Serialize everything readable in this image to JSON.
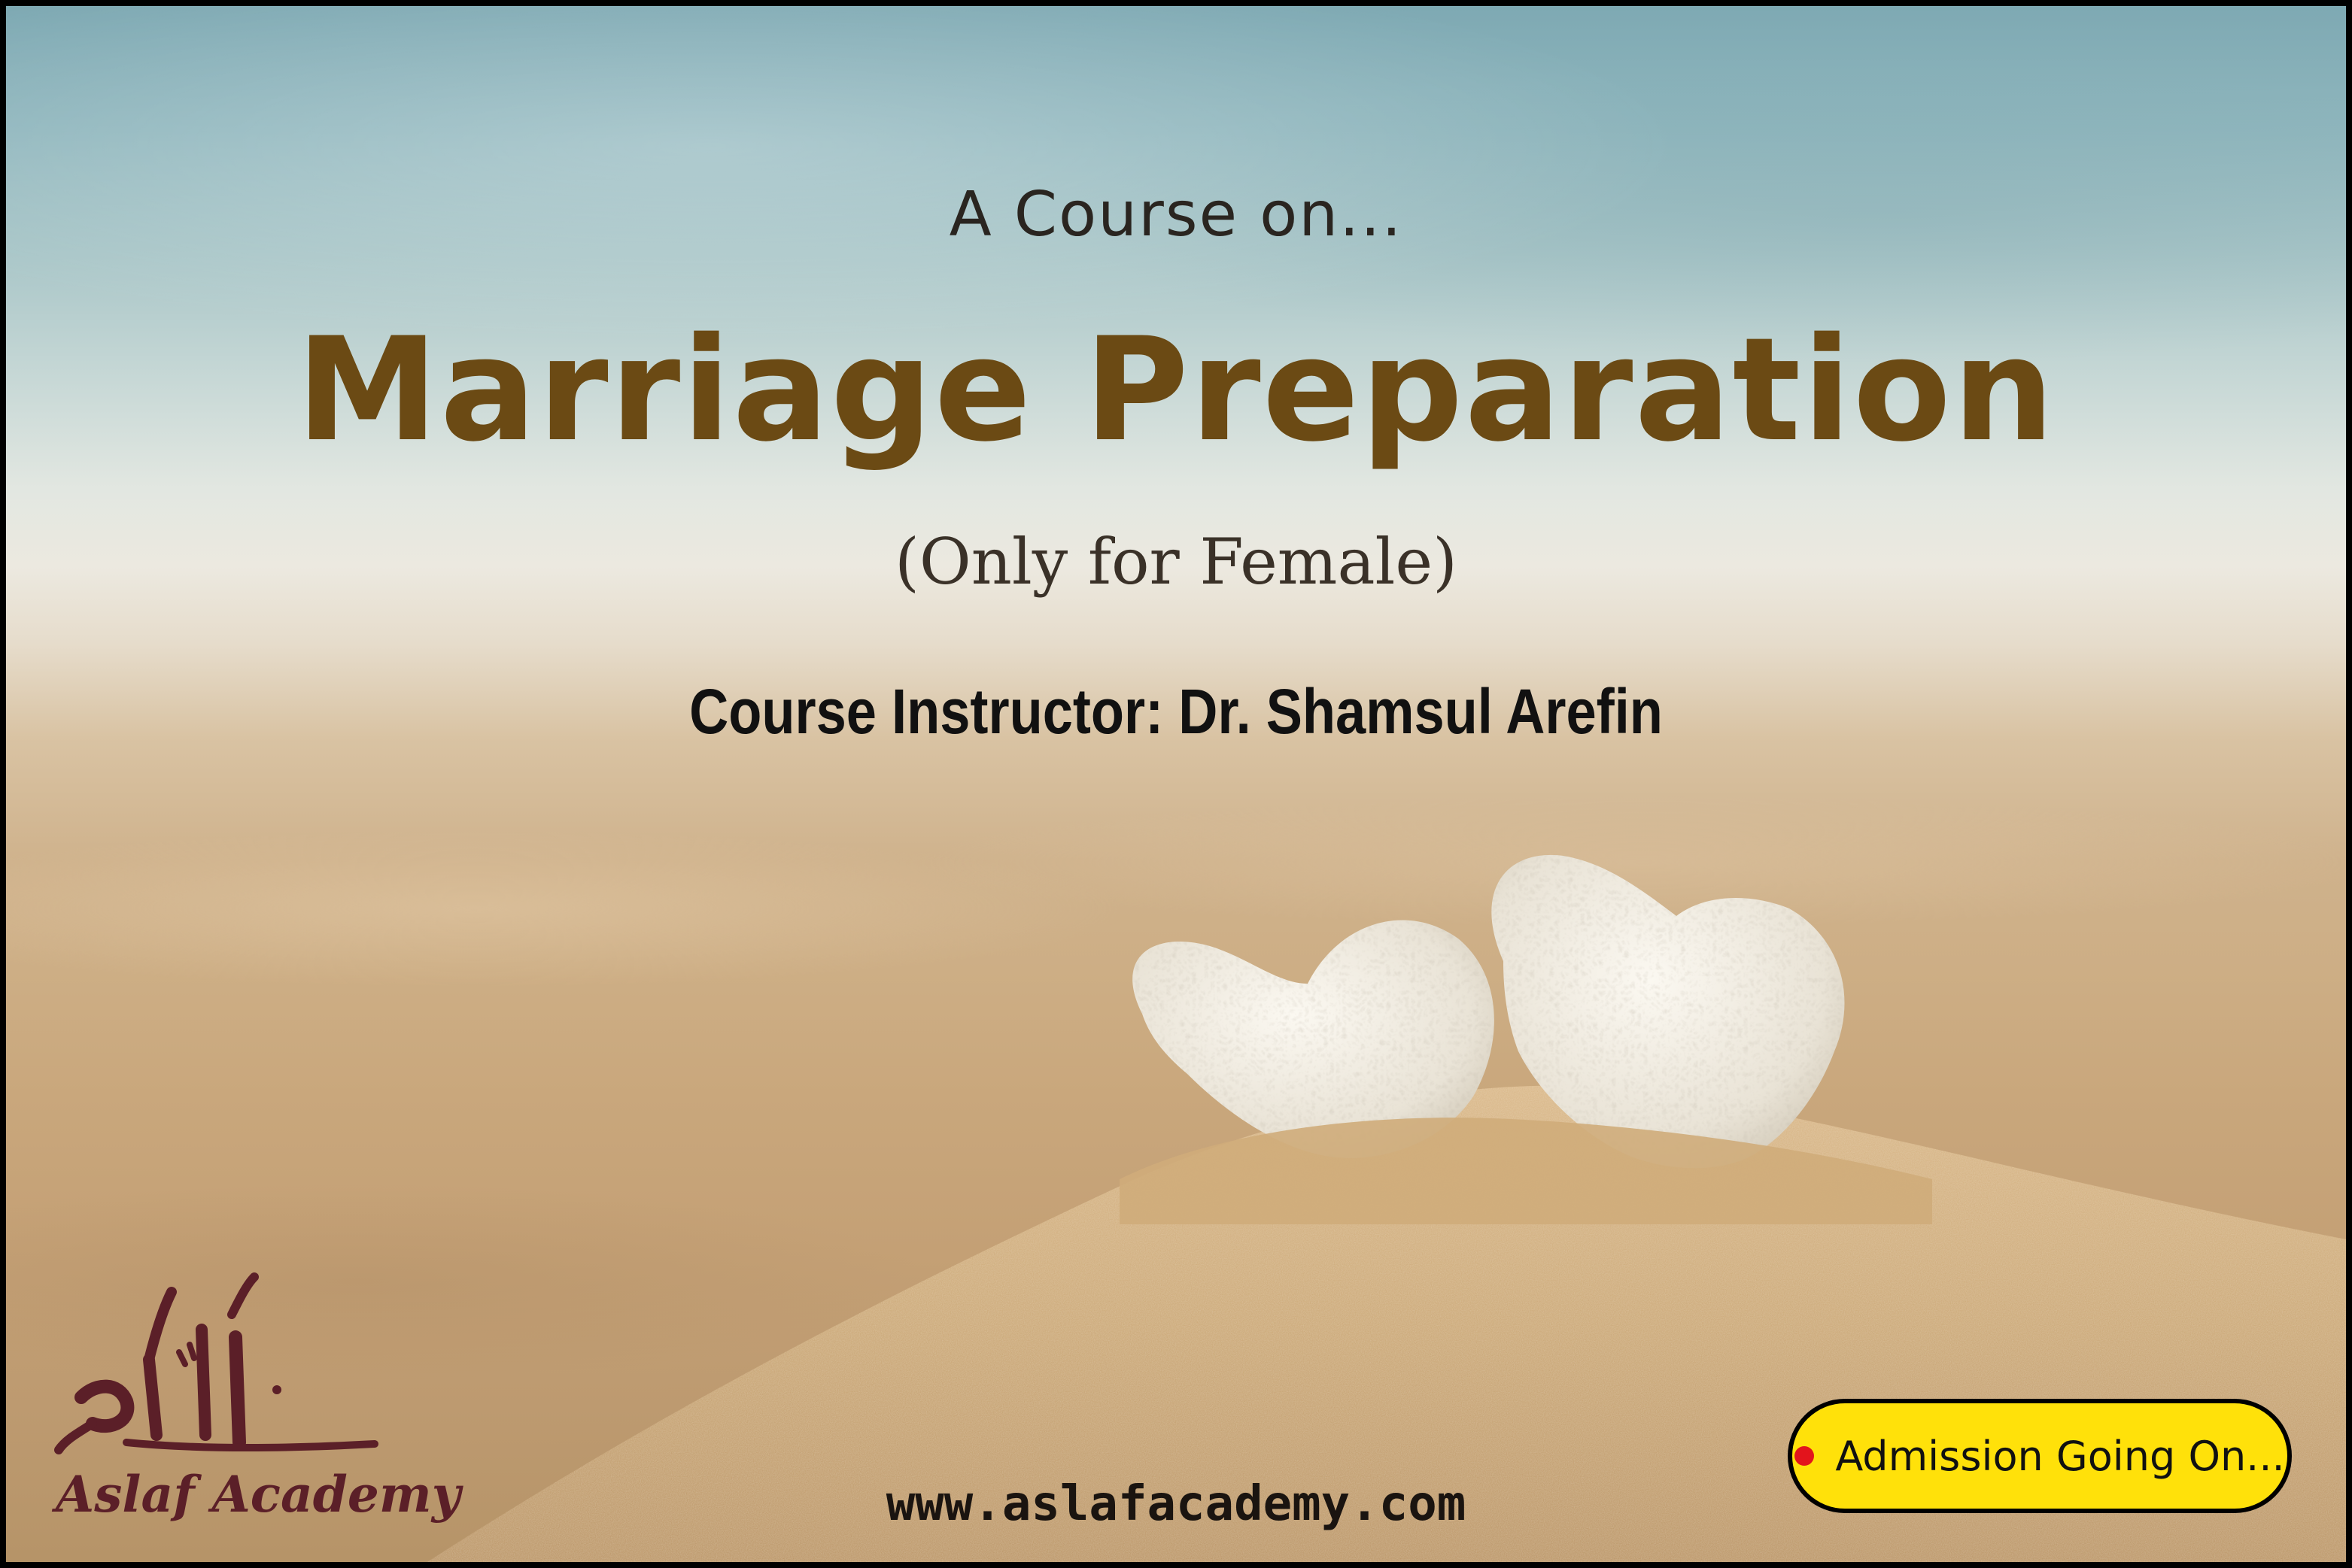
{
  "poster": {
    "intro": "A Course on...",
    "title": "Marriage Preparation",
    "audience_note": "(Only for Female)",
    "instructor_line": "Course Instructor: Dr. Shamsul Arefin",
    "website": "www.aslafacademy.com"
  },
  "brand": {
    "logo_name": "Aslaf Academy",
    "logo_color": "#5b1f28"
  },
  "badge": {
    "label": "Admission Going On...",
    "background": "#ffe10a",
    "dot_color": "#e3141c"
  },
  "colors": {
    "title": "#6b4a14",
    "text": "#111111"
  }
}
